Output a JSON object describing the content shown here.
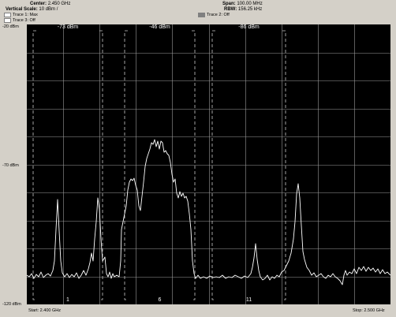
{
  "header": {
    "center_label": "Center:",
    "center_value": "2.450 GHz",
    "vscale_label": "Vertical Scale:",
    "vscale_value": "10 dBm /",
    "span_label": "Span:",
    "span_value": "100.00 MHz",
    "rbw_label": "RBW:",
    "rbw_value": "156.25 kHz"
  },
  "legend": {
    "trace1": "Trace 1: Max",
    "trace2": "Trace 2: Off",
    "trace3": "Trace 3: Off"
  },
  "axis": {
    "y_top": "-20 dBm",
    "y_mid": "-70 dBm",
    "y_bottom": "-120 dBm",
    "start": "Start: 2.400 GHz",
    "stop": "Stop: 2.500 GHz"
  },
  "channels": [
    {
      "number": "1",
      "level": "-73 dBm"
    },
    {
      "number": "6",
      "level": "-46 dBm"
    },
    {
      "number": "11",
      "level": "-86 dBm"
    }
  ],
  "colors": {
    "plot_bg": "#000000",
    "grid": "#9a9a9a",
    "trace": "#ffffff",
    "window": "#d4d0c8"
  }
}
